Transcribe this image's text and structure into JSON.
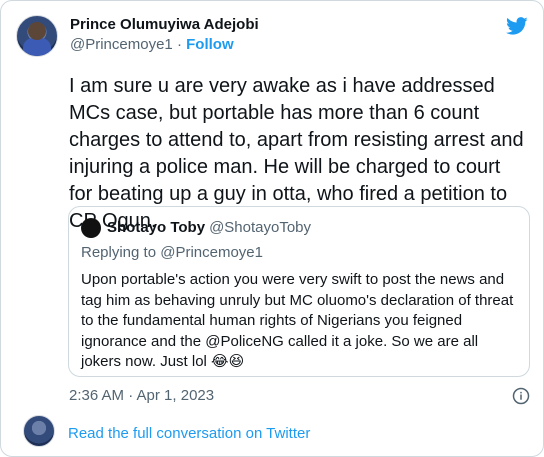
{
  "author": {
    "name": "Prince Olumuyiwa Adejobi",
    "handle": "@Princemoye1",
    "separator": "·",
    "follow_label": "Follow"
  },
  "tweet": {
    "text": "I am sure u are very awake as i have addressed MCs case, but portable has more than 6 count charges to attend to, apart from resisting arrest and injuring a police man. He will be charged to court for beating up a guy in otta, who fired a petition to CP Ogun.",
    "timestamp": "2:36 AM · Apr 1, 2023"
  },
  "quoted": {
    "name": "Shotayo Toby",
    "handle": "@ShotayoToby",
    "replying_prefix": "Replying to",
    "replying_to": "@Princemoye1",
    "text": "Upon portable's action you were very swift to post the news and tag him as behaving unruly but MC oluomo's declaration of threat to the fundamental human rights of Nigerians you feigned ignorance and the @PoliceNG called it a joke. So we are all jokers now. Just lol 😂😆"
  },
  "footer": {
    "link_label": "Read the full conversation on Twitter"
  },
  "icons": {
    "brand": "twitter-bird-icon",
    "info": "info-icon"
  },
  "colors": {
    "accent": "#1d9bf0",
    "text": "#0f1419",
    "secondary": "#536471",
    "border": "#cfd9de"
  }
}
